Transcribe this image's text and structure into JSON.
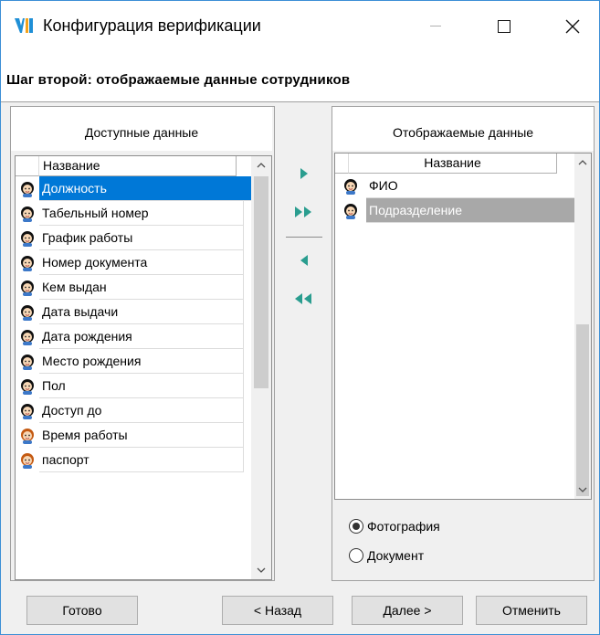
{
  "window": {
    "title": "Конфигурация верификации",
    "icon": "app-logo-icon",
    "accent": "#0078d7"
  },
  "step": {
    "title": "Шаг второй: отображаемые данные сотрудников"
  },
  "available": {
    "header": "Доступные данные",
    "column": "Название",
    "items": [
      {
        "label": "Должность",
        "icon": "person-dark-icon",
        "selected": true
      },
      {
        "label": "Табельный номер",
        "icon": "person-dark-icon"
      },
      {
        "label": "График работы",
        "icon": "person-dark-icon"
      },
      {
        "label": "Номер документа",
        "icon": "person-dark-icon"
      },
      {
        "label": "Кем выдан",
        "icon": "person-dark-icon"
      },
      {
        "label": "Дата выдачи",
        "icon": "person-dark-icon"
      },
      {
        "label": "Дата рождения",
        "icon": "person-dark-icon"
      },
      {
        "label": "Место рождения",
        "icon": "person-dark-icon"
      },
      {
        "label": "Пол",
        "icon": "person-dark-icon"
      },
      {
        "label": "Доступ до",
        "icon": "person-dark-icon"
      },
      {
        "label": "Время работы",
        "icon": "person-orange-icon"
      },
      {
        "label": "паспорт",
        "icon": "person-orange-icon"
      }
    ]
  },
  "displayed": {
    "header": "Отображаемые данные",
    "column": "Название",
    "items": [
      {
        "label": "ФИО",
        "icon": "person-dark-icon"
      },
      {
        "label": "Подразделение",
        "icon": "person-dark-icon",
        "selected": true
      }
    ]
  },
  "transfer": {
    "add_one": "arrow-right-icon",
    "add_all": "double-arrow-right-icon",
    "remove_one": "arrow-left-icon",
    "remove_all": "double-arrow-left-icon"
  },
  "mode": {
    "options": [
      "Фотография",
      "Документ"
    ],
    "selected": "Фотография"
  },
  "buttons": {
    "done": "Готово",
    "back": "< Назад",
    "next": "Далее >",
    "cancel": "Отменить"
  }
}
